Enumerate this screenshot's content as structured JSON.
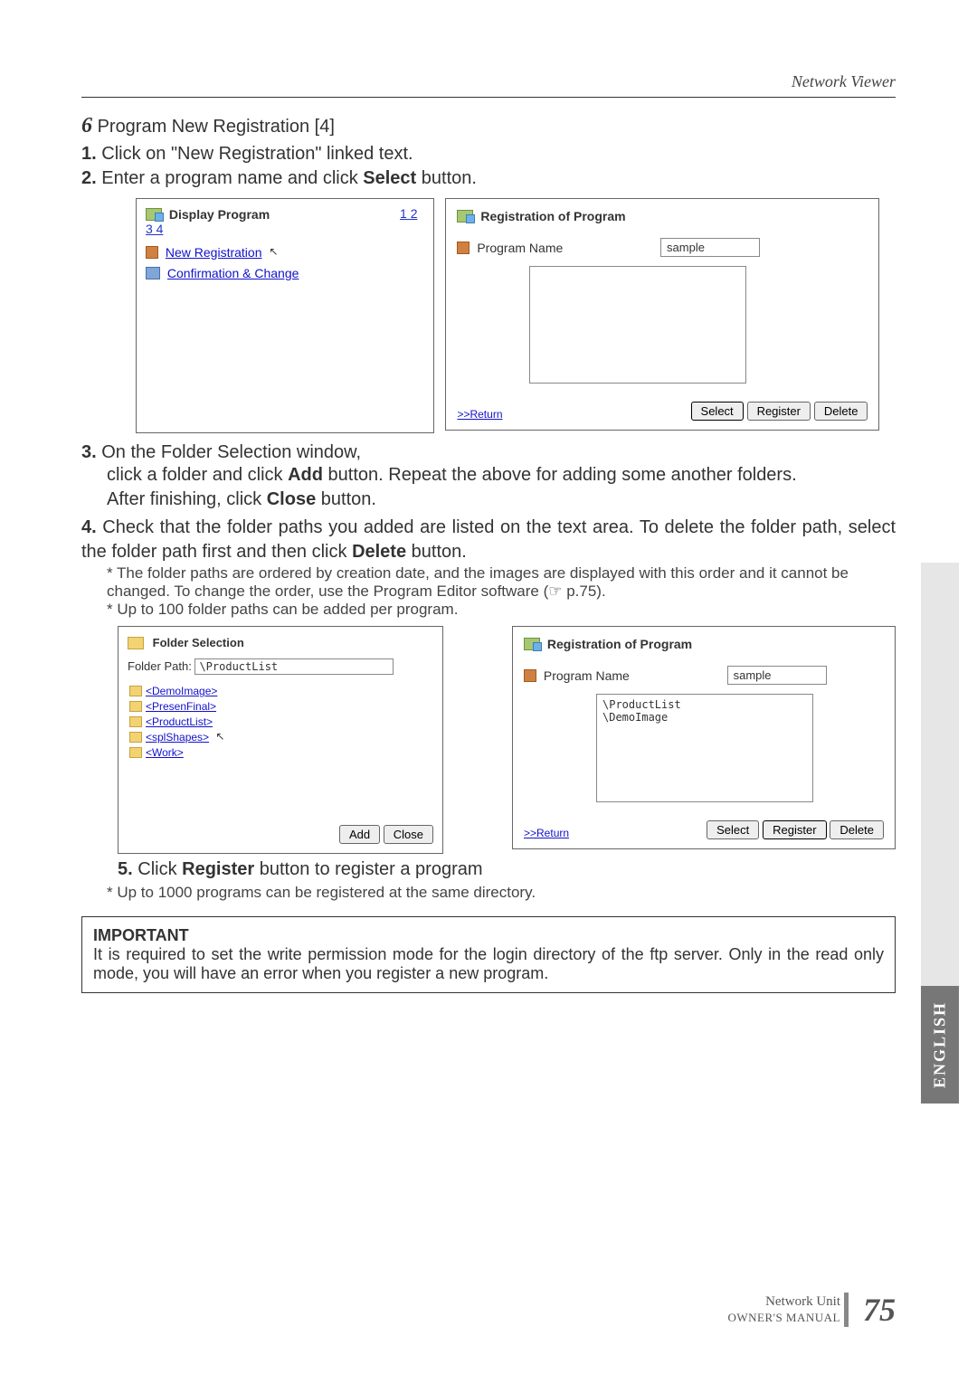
{
  "header": {
    "section": "Network  Viewer"
  },
  "step6": {
    "num": "6",
    "title": "Program New Registration [4]",
    "item1_n": "1.",
    "item1": "Click on \"New Registration\" linked text.",
    "item2_n": "2.",
    "item2_a": "Enter a program name and click ",
    "item2_b": "Select",
    "item2_c": " button."
  },
  "panel1": {
    "title": "Display Program",
    "pages": "1 2 3 4",
    "link_newreg": "New Registration",
    "link_confirm": "Confirmation & Change"
  },
  "regpanel": {
    "title": "Registration of Program",
    "progname_label": "Program Name",
    "progname_value": "sample",
    "return": ">>Return",
    "btn_select": "Select",
    "btn_register": "Register",
    "btn_delete": "Delete"
  },
  "item3": {
    "n": "3.",
    "a": "On  the  Folder  Selection  window,",
    "b": "click a folder and click ",
    "c": "Add",
    "d": " button. Repeat the above for adding some another folders.",
    "e": " After finishing, click ",
    "f": "Close",
    "g": " button."
  },
  "item4": {
    "n": "4.",
    "a": "Check  that  the  folder  paths  you  added  are  listed  on  the  text  area.  To  delete  the folder path, select the folder path first and then click ",
    "b": "Delete",
    "c": " button.",
    "note1": "* The folder paths are ordered by creation date, and the images are displayed with this order and it cannot be changed. To change the order, use the Program Editor software (☞ p.75).",
    "note2": "* Up to 100 folder paths can be added per program."
  },
  "folderpanel": {
    "title": "Folder Selection",
    "path_label": "Folder Path:",
    "path_value": "\\ProductList",
    "items": [
      "<DemoImage>",
      "<PresenFinal>",
      "<ProductList>",
      "<splShapes>",
      "<Work>"
    ],
    "btn_add": "Add",
    "btn_close": "Close"
  },
  "regpanel2": {
    "title": "Registration of Program",
    "progname_label": "Program Name",
    "progname_value": "sample",
    "textarea": "\\ProductList\n\\DemoImage",
    "return": ">>Return",
    "btn_select": "Select",
    "btn_register": "Register",
    "btn_delete": "Delete"
  },
  "item5": {
    "n": "5.",
    "a": "Click ",
    "b": "Register",
    "c": " button to register a program",
    "note": "* Up to 1000 programs can be registered at the same directory."
  },
  "important": {
    "label": "IMPORTANT",
    "text": "It is required to set the write permission mode for the login directory of the ftp server. Only in the read only mode, you will have an error when you register a new program."
  },
  "footer": {
    "nu": "Network Unit",
    "om": "OWNER'S MANUAL",
    "page": "75"
  },
  "sidetab": "ENGLISH"
}
